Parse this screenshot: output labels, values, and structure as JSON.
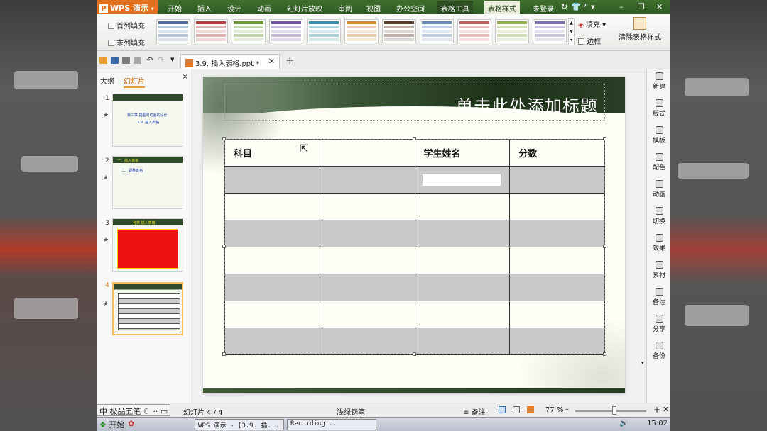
{
  "window": {
    "app_name": "WPS 演示",
    "logo_glyph": "P",
    "menus": [
      "开始",
      "插入",
      "设计",
      "动画",
      "幻灯片放映",
      "审阅",
      "视图",
      "办公空间"
    ],
    "context_tab": "表格工具",
    "active_tab": "表格样式",
    "login": "未登录",
    "help": "?",
    "controls": [
      "–",
      "❐",
      "✕"
    ]
  },
  "ribbon": {
    "first_col": "首列填充",
    "last_col": "末列填充",
    "fill": "填充",
    "border": "边框",
    "clear_style": "清除表格样式",
    "style_colors": [
      "#4a6fa0",
      "#b04040",
      "#6f9a3a",
      "#7055a0",
      "#3a90a8",
      "#d08a30",
      "#5a3a28",
      "#6a8ab8",
      "#c06060",
      "#90b050",
      "#8070b0"
    ]
  },
  "quickbar": {
    "doc_tab": "3.9. 插入表格.ppt *",
    "new_tab": "+"
  },
  "panel": {
    "tab_outline": "大纲",
    "tab_slides": "幻灯片",
    "thumbs": [
      {
        "num": "1",
        "line1": "第三章 插图与动画的设计",
        "line2": "3.9. 插入表格"
      },
      {
        "num": "2",
        "line1": "一、插入表格",
        "line2": "二、调整表格"
      },
      {
        "num": "3",
        "line1": "各类 插入表格"
      },
      {
        "num": "4"
      }
    ]
  },
  "slide": {
    "title": "单击此处添加标题",
    "table": {
      "header": [
        "科目",
        "",
        "学生姓名",
        "分数"
      ],
      "rows": 7
    }
  },
  "right_bar": [
    "新建",
    "版式",
    "模板",
    "配色",
    "动画",
    "切换",
    "效果",
    "素材",
    "备注",
    "分享",
    "备份"
  ],
  "status": {
    "ime": "中 极品五笔",
    "slide_info": "幻灯片 4 / 4",
    "theme": "浅绿钢笔",
    "notes": "备注",
    "zoom": "77 %",
    "zoom_level": 0.55
  },
  "taskbar": {
    "start": "开始",
    "tasks": [
      "WPS 演示 - [3.9. 插...",
      "Recording..."
    ],
    "clock": "15:02"
  }
}
